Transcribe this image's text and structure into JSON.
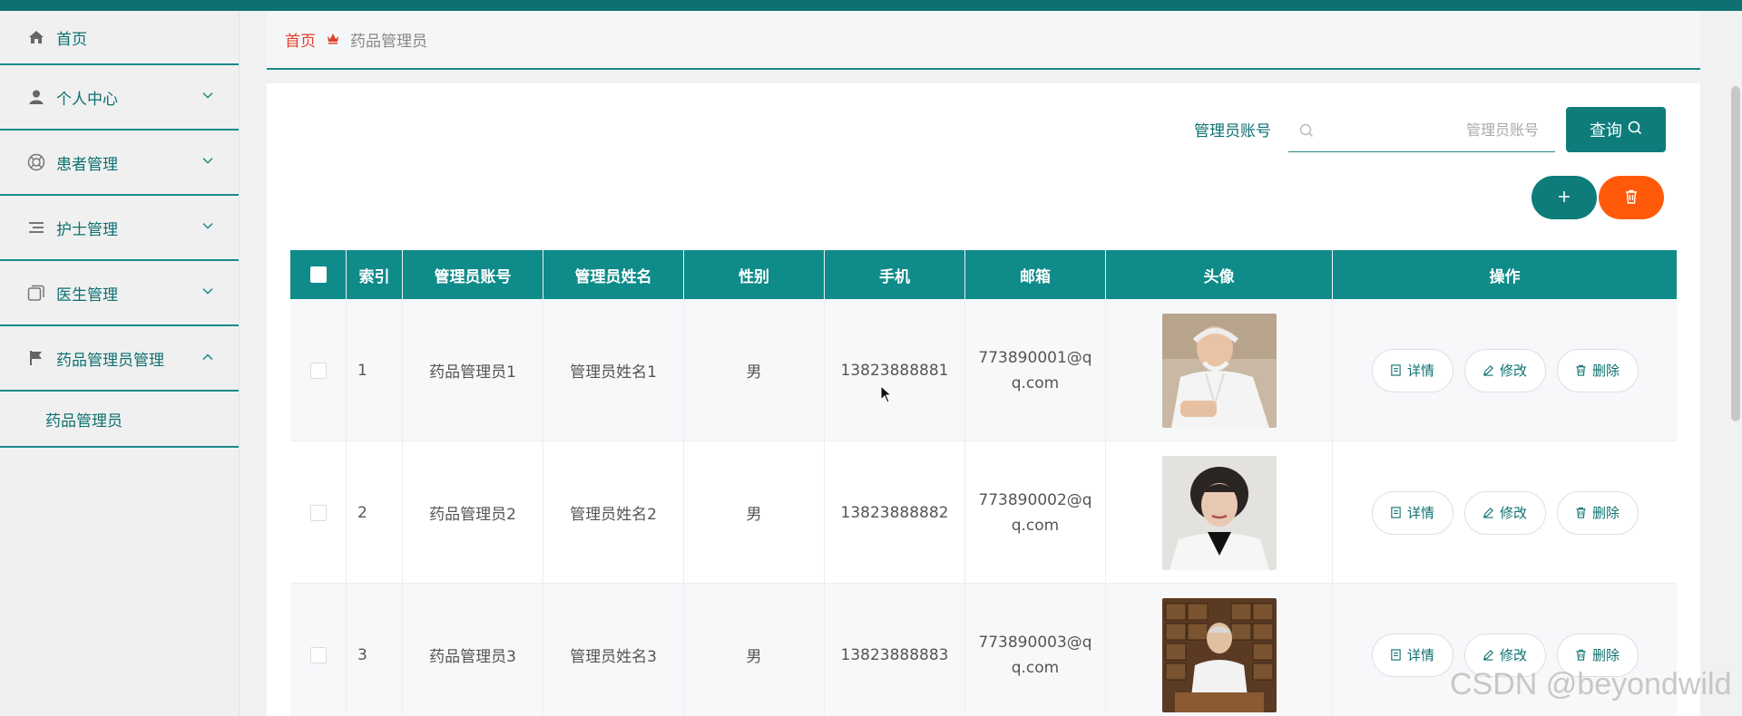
{
  "sidebar": {
    "items": [
      {
        "label": "首页",
        "icon": "home-icon"
      },
      {
        "label": "个人中心",
        "icon": "user-icon"
      },
      {
        "label": "患者管理",
        "icon": "lifebuoy-icon"
      },
      {
        "label": "护士管理",
        "icon": "list-icon"
      },
      {
        "label": "医生管理",
        "icon": "copy-icon"
      },
      {
        "label": "药品管理员管理",
        "icon": "flag-icon"
      }
    ],
    "submenu": {
      "label": "药品管理员"
    }
  },
  "breadcrumb": {
    "home": "首页",
    "current": "药品管理员"
  },
  "search": {
    "label": "管理员账号",
    "placeholder": "管理员账号",
    "value": "",
    "button_label": "查询"
  },
  "table": {
    "headers": [
      "索引",
      "管理员账号",
      "管理员姓名",
      "性别",
      "手机",
      "邮箱",
      "头像",
      "操作"
    ],
    "rows": [
      {
        "index": "1",
        "account": "药品管理员1",
        "name": "管理员姓名1",
        "gender": "男",
        "phone": "13823888881",
        "email": "773890001@qq.com"
      },
      {
        "index": "2",
        "account": "药品管理员2",
        "name": "管理员姓名2",
        "gender": "男",
        "phone": "13823888882",
        "email": "773890002@qq.com"
      },
      {
        "index": "3",
        "account": "药品管理员3",
        "name": "管理员姓名3",
        "gender": "男",
        "phone": "13823888883",
        "email": "773890003@qq.com"
      }
    ],
    "actions": {
      "detail": "详情",
      "edit": "修改",
      "delete": "删除"
    }
  },
  "watermark": "CSDN @beyondwild",
  "colors": {
    "primary": "#0e7c7b",
    "danger": "#ff5a0a",
    "breadcrumb_home": "#e0402a"
  }
}
